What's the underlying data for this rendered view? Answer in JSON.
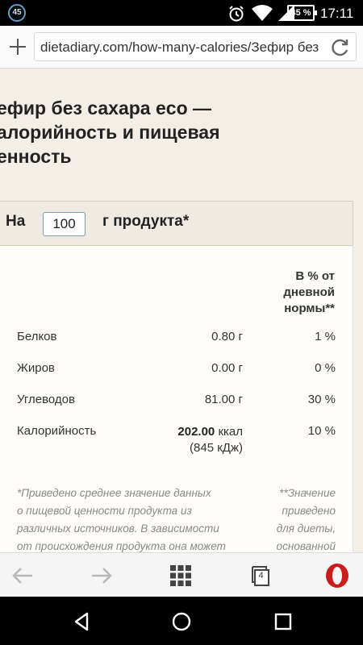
{
  "status_bar": {
    "notification_badge": "45",
    "battery": "45 %",
    "time": "17:11",
    "icons": [
      "alarm-icon",
      "wifi-icon",
      "signal-icon",
      "battery-icon"
    ]
  },
  "address_bar": {
    "url": "dietadiary.com/how-many-calories/Зефир без",
    "icons": [
      "plus-icon",
      "reload-icon"
    ]
  },
  "page": {
    "title_lines": [
      "ефир без сахара eco —",
      "алорийность и пищевая",
      "енность"
    ],
    "portion": {
      "prefix": "На",
      "value": "100",
      "suffix": "г продукта*"
    },
    "table": {
      "percent_header": [
        "В % от",
        "дневной",
        "нормы**"
      ],
      "rows": [
        {
          "name": "Белков",
          "amount": "0.80 г",
          "percent": "1 %"
        },
        {
          "name": "Жиров",
          "amount": "0.00 г",
          "percent": "0 %"
        },
        {
          "name": "Углеводов",
          "amount": "81.00 г",
          "percent": "30 %"
        }
      ],
      "calories": {
        "name": "Калорийность",
        "value": "202.00",
        "unit": " ккал",
        "kj": "(845 кДж)",
        "percent": "10 %"
      }
    },
    "footnote_left": [
      "*Приведено среднее значение данных",
      "о пищевой ценности продукта из",
      "различных источников. В зависимости",
      "от происхождения продукта она может"
    ],
    "footnote_right": [
      "**Значение",
      "приведено",
      "для диеты,",
      "основанной"
    ]
  },
  "browser_toolbar": {
    "tab_count": "4",
    "icons": [
      "back-arrow-icon",
      "forward-arrow-icon",
      "speed-dial-icon",
      "tabs-icon",
      "opera-logo-icon"
    ]
  },
  "nav_bar": {
    "icons": [
      "back-triangle-icon",
      "home-circle-icon",
      "recents-square-icon"
    ]
  },
  "colors": {
    "page_background": "#f3efe6",
    "card_background": "#fffdfa",
    "opera_red": "#cc1b1b",
    "input_border": "#7d9bb8"
  }
}
